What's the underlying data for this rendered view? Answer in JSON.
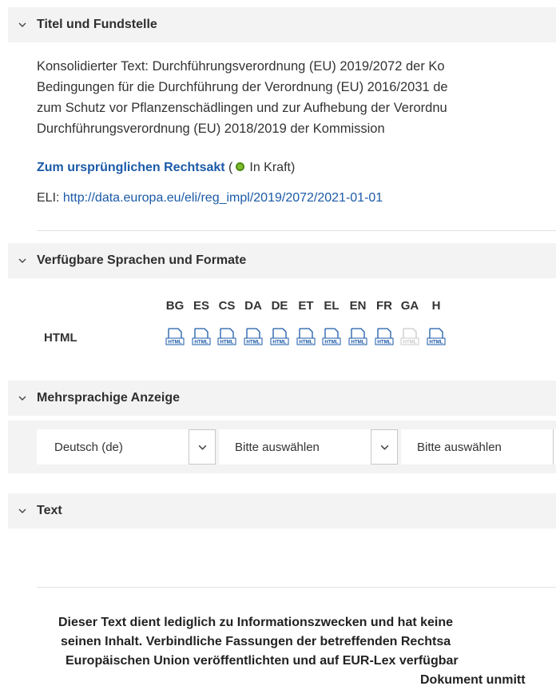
{
  "sections": {
    "title": {
      "heading": "Titel und Fundstelle"
    },
    "languages": {
      "heading": "Verfügbare Sprachen und Formate"
    },
    "multilingual": {
      "heading": "Mehrsprachige Anzeige"
    },
    "text": {
      "heading": "Text"
    }
  },
  "document": {
    "title_lines": [
      "Konsolidierter Text: Durchführungsverordnung (EU) 2019/2072 der Ko",
      "Bedingungen für die Durchführung der Verordnung (EU) 2016/2031 de",
      "zum Schutz vor Pflanzenschädlingen und zur Aufhebung der Verordnu",
      "Durchführungsverordnung (EU) 2018/2019 der Kommission"
    ],
    "original_link": "Zum ursprünglichen Rechtsakt",
    "status_open": "(",
    "status": "In Kraft)",
    "eli_label": "ELI: ",
    "eli_url": "http://data.europa.eu/eli/reg_impl/2019/2072/2021-01-01"
  },
  "formats": {
    "languages": [
      "BG",
      "ES",
      "CS",
      "DA",
      "DE",
      "ET",
      "EL",
      "EN",
      "FR",
      "GA",
      "H"
    ],
    "row_label": "HTML",
    "icon_text": "HTML",
    "available": [
      true,
      true,
      true,
      true,
      true,
      true,
      true,
      true,
      true,
      false,
      true
    ],
    "colors": {
      "available": "#1b5aa8",
      "unavailable": "#c9c9c9"
    }
  },
  "multilingual": {
    "select1": "Deutsch (de)",
    "select2": "Bitte auswählen",
    "select3": "Bitte auswählen"
  },
  "notice": {
    "lines": [
      "Dieser Text dient lediglich zu Informationszwecken und hat keine",
      "seinen Inhalt. Verbindliche Fassungen der betreffenden Rechtsa",
      "Europäischen Union veröffentlichten und auf EUR-Lex verfügbar",
      "Dokument unmitt"
    ]
  }
}
